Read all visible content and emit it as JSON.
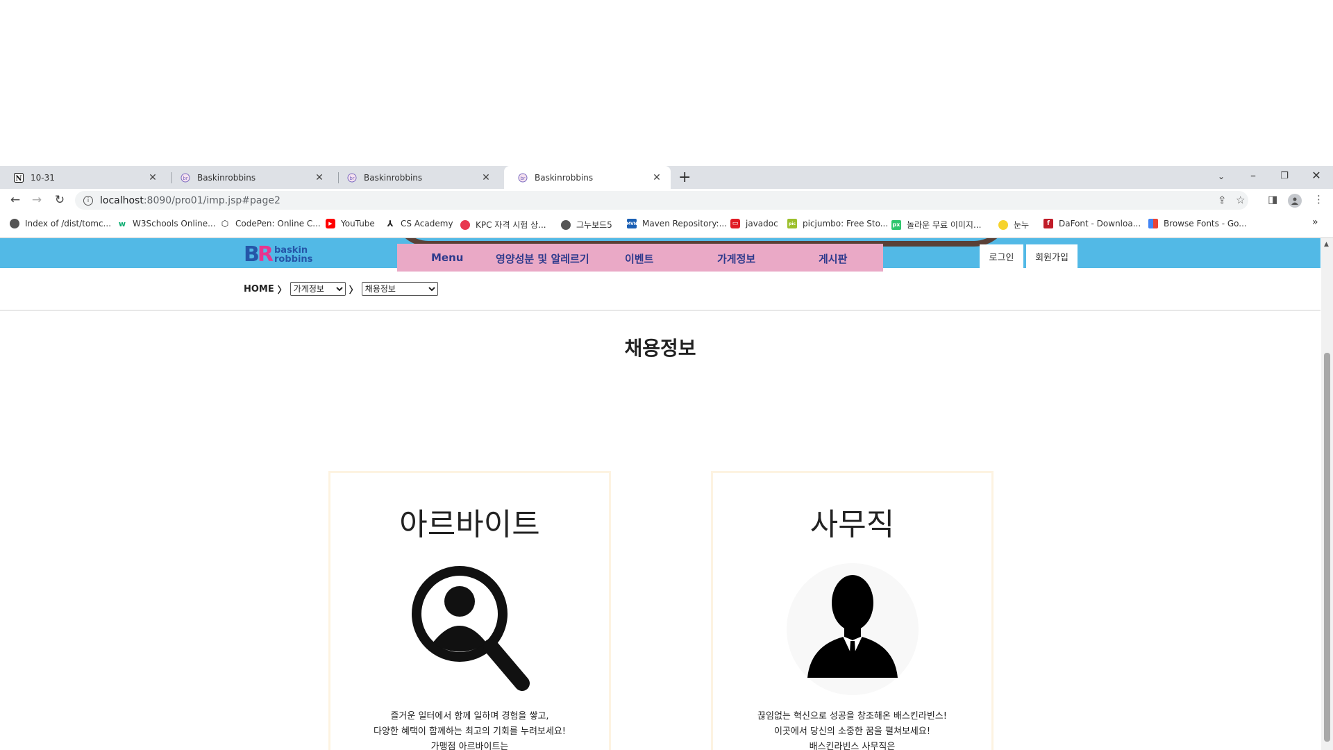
{
  "browser": {
    "tabs": [
      {
        "title": "10-31",
        "favicon": "notion-icon",
        "active": false
      },
      {
        "title": "Baskinrobbins",
        "favicon": "br-favicon",
        "active": false
      },
      {
        "title": "Baskinrobbins",
        "favicon": "br-favicon",
        "active": false
      },
      {
        "title": "Baskinrobbins",
        "favicon": "br-favicon",
        "active": true
      }
    ],
    "new_tab": "+",
    "url_host": "localhost",
    "url_path": ":8090/pro01/imp.jsp#page2",
    "bookmarks": [
      {
        "label": "Index of /dist/tomc...",
        "icon": "globe-icon",
        "color": "#555555"
      },
      {
        "label": "W3Schools Online...",
        "icon": "w3schools-icon",
        "color": "#04aa6d"
      },
      {
        "label": "CodePen: Online C...",
        "icon": "codepen-icon",
        "color": "#222222"
      },
      {
        "label": "YouTube",
        "icon": "youtube-icon",
        "color": "#ff0000"
      },
      {
        "label": "CS Academy",
        "icon": "cs-academy-icon",
        "color": "#222222"
      },
      {
        "label": "KPC 자격 시험 상...",
        "icon": "kpc-icon",
        "color": "#e8384f"
      },
      {
        "label": "그누보드5",
        "icon": "globe-icon",
        "color": "#555555"
      },
      {
        "label": "Maven Repository:...",
        "icon": "maven-icon",
        "color": "#1a5fb4"
      },
      {
        "label": "javadoc",
        "icon": "javadoc-icon",
        "color": "#e01b24"
      },
      {
        "label": "picjumbo: Free Sto...",
        "icon": "picjumbo-icon",
        "color": "#9bbf2b"
      },
      {
        "label": "놀라운 무료 이미지...",
        "icon": "pixabay-icon",
        "color": "#2ec66d"
      },
      {
        "label": "눈누",
        "icon": "noonnu-icon",
        "color": "#f6d32d"
      },
      {
        "label": "DaFont - Downloa...",
        "icon": "dafont-icon",
        "color": "#c01c28"
      },
      {
        "label": "Browse Fonts - Go...",
        "icon": "google-fonts-icon",
        "color": "#4285f4"
      }
    ],
    "more_bookmarks": "»"
  },
  "site": {
    "logo_text_1": "baskin",
    "logo_text_2": "robbins",
    "nav": [
      "Menu",
      "영양성분 및 알레르기",
      "이벤트",
      "가게정보",
      "게시판"
    ],
    "login": "로그인",
    "signup": "회원가입",
    "breadcrumb": {
      "home": "HOME",
      "sep": "〉",
      "select1": "가게정보",
      "select2": "채용정보"
    },
    "heading": "채용정보",
    "cards": [
      {
        "title": "아르바이트",
        "icon": "job-search-icon",
        "lines": [
          "즐거운 일터에서 함께 일하며 경험을 쌓고,",
          "다양한 혜택이 함께하는 최고의 기회를 누려보세요!",
          "가맹점 아르바이트는"
        ]
      },
      {
        "title": "사무직",
        "icon": "businessman-icon",
        "lines": [
          "끊임없는 혁신으로 성공을 창조해온 배스킨라빈스!",
          "이곳에서 당신의 소중한 꿈을 펼쳐보세요!",
          "배스킨라빈스 사무직은"
        ]
      }
    ]
  },
  "colors": {
    "blue_band": "#52b9e6",
    "nav_pink": "#eaa9c6",
    "nav_text": "#2e3a8c",
    "card_border": "#fdf3e1"
  }
}
